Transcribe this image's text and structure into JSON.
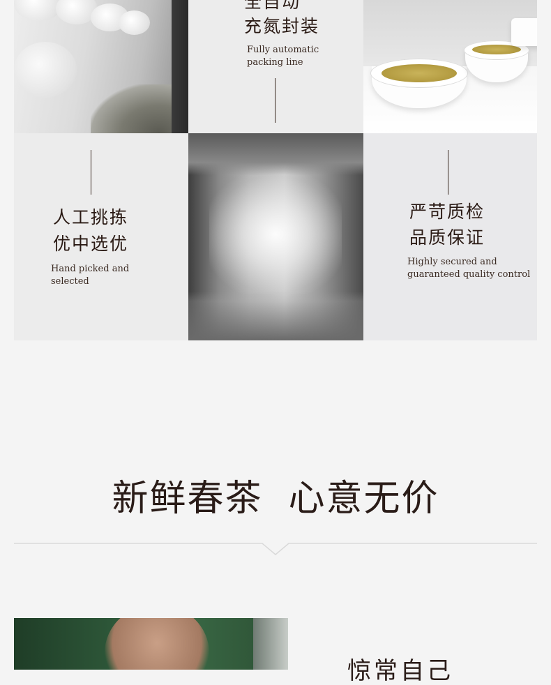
{
  "tiles": {
    "packing": {
      "title_lines": [
        "全自动",
        "充氮封装"
      ],
      "subtitle_lines": [
        "Fully automatic",
        "packing line"
      ]
    },
    "picking": {
      "title_lines": [
        "人工挑拣",
        "优中选优"
      ],
      "subtitle_lines": [
        "Hand picked and",
        "selected"
      ]
    },
    "quality": {
      "title_lines": [
        "严苛质检",
        "品质保证"
      ],
      "subtitle_lines": [
        "Highly secured and",
        "guaranteed quality control"
      ]
    }
  },
  "section": {
    "headline": "新鲜春茶  心意无价"
  },
  "next_section": {
    "heading": "惊常自己"
  },
  "colors": {
    "page_background": "#f4f4f4",
    "tile_background": "#ececec",
    "text_dark": "#2a1c18",
    "divider": "#d9d9d9"
  }
}
